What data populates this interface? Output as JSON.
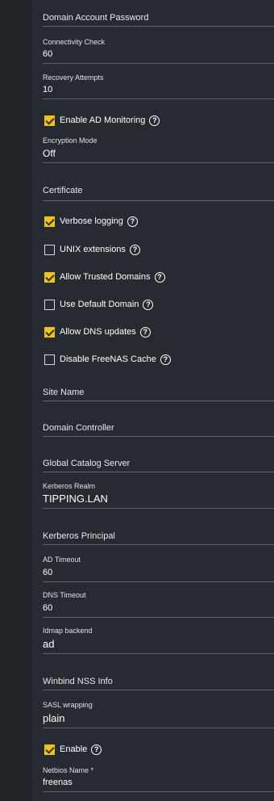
{
  "fields": {
    "domain_account_password": {
      "label": "Domain Account Password"
    },
    "connectivity_check": {
      "label": "Connectivity Check",
      "value": "60"
    },
    "recovery_attempts": {
      "label": "Recovery Attempts",
      "value": "10"
    },
    "encryption_mode": {
      "label": "Encryption Mode",
      "value": "Off"
    },
    "certificate": {
      "label": "Certificate"
    },
    "site_name": {
      "label": "Site Name"
    },
    "domain_controller": {
      "label": "Domain Controller"
    },
    "global_catalog_server": {
      "label": "Global Catalog Server"
    },
    "kerberos_realm": {
      "label": "Kerberos Realm",
      "value": "TIPPING.LAN"
    },
    "kerberos_principal": {
      "label": "Kerberos Principal"
    },
    "ad_timeout": {
      "label": "AD Timeout",
      "value": "60"
    },
    "dns_timeout": {
      "label": "DNS Timeout",
      "value": "60"
    },
    "idmap_backend": {
      "label": "Idmap backend",
      "value": "ad"
    },
    "winbind_nss_info": {
      "label": "Winbind NSS Info"
    },
    "sasl_wrapping": {
      "label": "SASL wrapping",
      "value": "plain"
    },
    "netbios_name": {
      "label": "Netbios Name *",
      "value": "freenas"
    }
  },
  "checkboxes": {
    "enable_ad_monitoring": {
      "label": "Enable AD Monitoring",
      "checked": true,
      "help": "?"
    },
    "verbose_logging": {
      "label": "Verbose logging",
      "checked": true,
      "help": "?"
    },
    "unix_extensions": {
      "label": "UNIX extensions",
      "checked": false,
      "help": "?"
    },
    "allow_trusted_domains": {
      "label": "Allow Trusted Domains",
      "checked": true,
      "help": "?"
    },
    "use_default_domain": {
      "label": "Use Default Domain",
      "checked": false,
      "help": "?"
    },
    "allow_dns_updates": {
      "label": "Allow DNS updates",
      "checked": true,
      "help": "?"
    },
    "disable_freenas_cache": {
      "label": "Disable FreeNAS Cache",
      "checked": false,
      "help": "?"
    },
    "enable": {
      "label": "Enable",
      "checked": true,
      "help": "?"
    }
  },
  "colors": {
    "accent_checkbox": "#f1c40f",
    "panel_background": "#252b30",
    "underline": "#5b6268"
  }
}
